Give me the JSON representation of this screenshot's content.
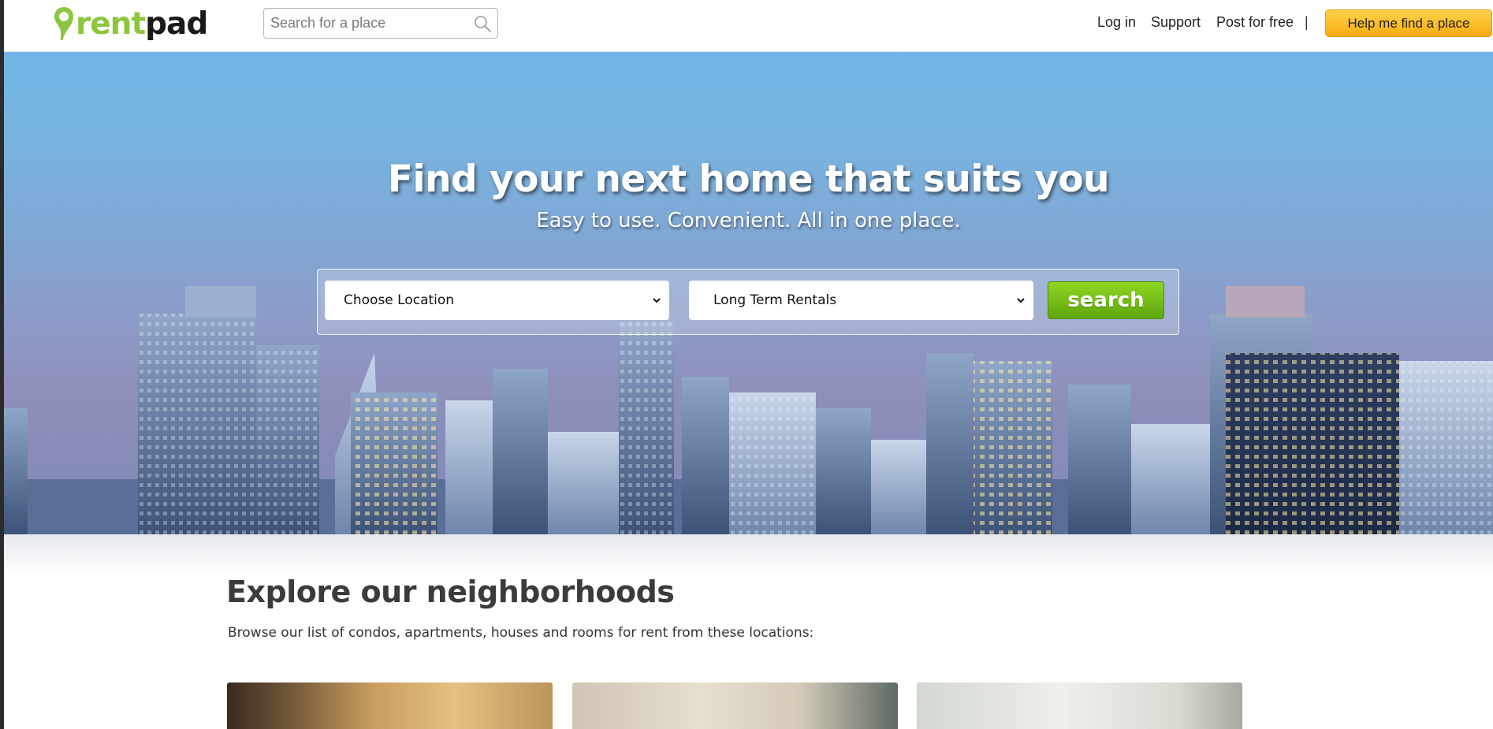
{
  "brand": {
    "logo_rent": "rent",
    "logo_pad": "pad",
    "logo_green": "#8cc63f"
  },
  "header": {
    "search_placeholder": "Search for a place",
    "nav": {
      "login": "Log in",
      "support": "Support",
      "post": "Post for free",
      "separator": "|"
    },
    "help_button": "Help me find a place"
  },
  "hero": {
    "title": "Find your next home that suits you",
    "subtitle": "Easy to use. Convenient. All in one place.",
    "location_select": "Choose Location",
    "type_select": "Long Term Rentals",
    "search_button": "search"
  },
  "neighborhoods": {
    "title": "Explore our neighborhoods",
    "description": "Browse our list of condos, apartments, houses and rooms for rent from these locations:"
  },
  "colors": {
    "accent_green": "#7cc01a",
    "help_button": "#f9b823"
  }
}
